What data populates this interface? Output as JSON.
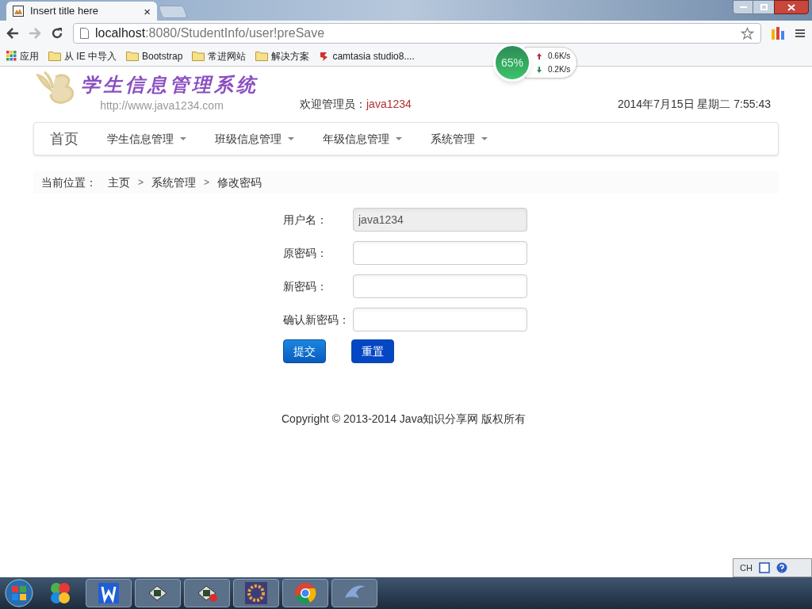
{
  "browser": {
    "tab_title": "Insert title here",
    "tab_close": "×",
    "url_host": "localhost",
    "url_rest": ":8080/StudentInfo/user!preSave",
    "bookmarks": [
      {
        "label": "应用",
        "kind": "apps"
      },
      {
        "label": "从 IE 中导入",
        "kind": "folder"
      },
      {
        "label": "Bootstrap",
        "kind": "folder"
      },
      {
        "label": "常进网站",
        "kind": "folder"
      },
      {
        "label": "解决方案",
        "kind": "folder"
      },
      {
        "label": "camtasia studio8....",
        "kind": "site"
      }
    ]
  },
  "net_widget": {
    "percent": "65%",
    "up": "0.6K/s",
    "down": "0.2K/s"
  },
  "header": {
    "logo_title": "学生信息管理系统",
    "logo_url": "http://www.java1234.com",
    "welcome_label": "欢迎管理员：",
    "welcome_user": "java1234",
    "datetime": "2014年7月15日 星期二 7:55:43"
  },
  "nav": [
    {
      "label": "首页",
      "dropdown": false
    },
    {
      "label": "学生信息管理",
      "dropdown": true
    },
    {
      "label": "班级信息管理",
      "dropdown": true
    },
    {
      "label": "年级信息管理",
      "dropdown": true
    },
    {
      "label": "系统管理",
      "dropdown": true
    }
  ],
  "breadcrumb": {
    "label": "当前位置：",
    "items": [
      "主页",
      ">",
      "系统管理",
      ">",
      "修改密码"
    ]
  },
  "form": {
    "fields": [
      {
        "label": "用户名：",
        "value": "java1234",
        "disabled": true
      },
      {
        "label": "原密码：",
        "disabled": false
      },
      {
        "label": "新密码：",
        "disabled": false
      },
      {
        "label": "确认新密码：",
        "disabled": false
      }
    ],
    "buttons": [
      {
        "label": "提交",
        "focused": false
      },
      {
        "label": "重置",
        "focused": true
      }
    ]
  },
  "footer": "Copyright © 2013-2014 Java知识分享网 版权所有",
  "tray": {
    "lang": "CH"
  }
}
